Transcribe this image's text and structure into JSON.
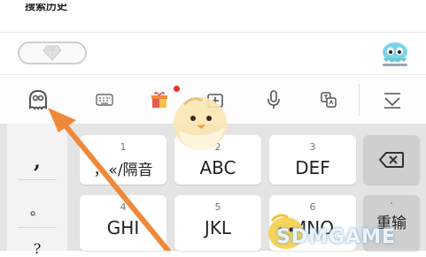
{
  "top": {
    "heading_text": "搜索历史"
  },
  "toolbar": {
    "items": [
      {
        "icon": "ghost-skin-icon"
      },
      {
        "icon": "keyboard-icon"
      },
      {
        "icon": "gift-icon",
        "badge": true
      },
      {
        "icon": "clipboard-add-icon"
      },
      {
        "icon": "microphone-icon"
      },
      {
        "icon": "translate-icon"
      },
      {
        "icon": "collapse-keyboard-icon"
      }
    ],
    "badge_color": "#e5302a"
  },
  "keyboard": {
    "side_keys": [
      ",",
      "。",
      "?"
    ],
    "keys": [
      {
        "num": "1",
        "label": "，«/隔音"
      },
      {
        "num": "2",
        "label": "ABC"
      },
      {
        "num": "3",
        "label": "DEF"
      },
      {
        "num": "4",
        "label": "GHI"
      },
      {
        "num": "5",
        "label": "JKL"
      },
      {
        "num": "6",
        "label": "MNO"
      }
    ],
    "backspace_icon": "backspace-icon",
    "retype": {
      "num": "·",
      "label": "重输"
    }
  },
  "overlay": {
    "arrow_color": "#f0883a",
    "watermark": "SDMGAME"
  }
}
